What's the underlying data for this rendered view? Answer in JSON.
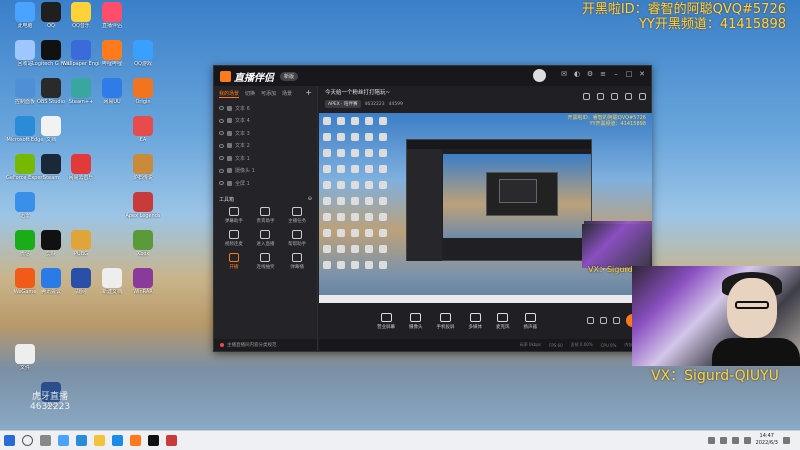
{
  "desktop": {
    "icons": [
      {
        "label": "此电脑",
        "color": "#4aa3ff"
      },
      {
        "label": "QQ",
        "color": "#1f1f1f"
      },
      {
        "label": "QQ音乐",
        "color": "#ffd23a"
      },
      {
        "label": "直播伴侣",
        "color": "#ff4d6a"
      },
      {
        "label": "回收站",
        "color": "#9ec7ff"
      },
      {
        "label": "Logitech G HUB",
        "color": "#111111"
      },
      {
        "label": "Wallpaper Engine",
        "color": "#3a6bd8"
      },
      {
        "label": "哔哩哔哩",
        "color": "#ff7a1a"
      },
      {
        "label": "QQ游戏",
        "color": "#3aa0ff"
      },
      {
        "label": "控制面板",
        "color": "#4f8fd6"
      },
      {
        "label": "OBS Studio",
        "color": "#2a2a2a"
      },
      {
        "label": "Steam++",
        "color": "#3aa6a0"
      },
      {
        "label": "网易UU",
        "color": "#2f7be8"
      },
      {
        "label": "Origin",
        "color": "#f2741f"
      },
      {
        "label": "Microsoft Edge",
        "color": "#2a8bd8"
      },
      {
        "label": "文档",
        "color": "#f2f2f2"
      },
      {
        "label": "EA",
        "color": "#e84b4b"
      },
      {
        "label": "GeForce Experience",
        "color": "#76b900"
      },
      {
        "label": "Steam",
        "color": "#1b2838"
      },
      {
        "label": "网易云音乐",
        "color": "#e23a3a"
      },
      {
        "label": "炉石传说",
        "color": "#c98a3a"
      },
      {
        "label": "迅雷",
        "color": "#3a8fe8"
      },
      {
        "label": "Apex Legends",
        "color": "#c93a3a"
      },
      {
        "label": "微信",
        "color": "#1aad19"
      },
      {
        "label": "剪映",
        "color": "#111111"
      },
      {
        "label": "PUBG",
        "color": "#e0a53a"
      },
      {
        "label": "Xbox",
        "color": "#5a9a3a"
      },
      {
        "label": "WeGame",
        "color": "#f25a1a"
      },
      {
        "label": "腾讯会议",
        "color": "#2a7be8"
      },
      {
        "label": "战网",
        "color": "#2a4fa8"
      },
      {
        "label": "新建文档",
        "color": "#eeeeee"
      },
      {
        "label": "WinRAR",
        "color": "#8a3a9a"
      },
      {
        "label": "文件",
        "color": "#eeeeee"
      },
      {
        "label": "Arc",
        "color": "#2a4f8a"
      }
    ]
  },
  "overlay": {
    "line1": "开黑啦ID：睿智的阿聪QVQ#5726",
    "line2": "YY开黑频道：41415898"
  },
  "app": {
    "logo": "直播伴侣",
    "version": "新版",
    "left_tabs": [
      "我的场景",
      "切换",
      "可添加",
      "场景"
    ],
    "sources": [
      "文本 6",
      "文本 4",
      "文本 3",
      "文本 2",
      "文本 1",
      "摄像头 1",
      "全屏 1"
    ],
    "tools_title": "工具箱",
    "tools": [
      {
        "label": "弹幕助手",
        "hot": false
      },
      {
        "label": "贵宾助手",
        "hot": false
      },
      {
        "label": "主播任务",
        "hot": false
      },
      {
        "label": "视频连麦",
        "hot": false
      },
      {
        "label": "进入直播",
        "hot": false
      },
      {
        "label": "帮帮助手",
        "hot": false
      },
      {
        "label": "开播",
        "hot": true
      },
      {
        "label": "连线抽奖",
        "hot": false
      },
      {
        "label": "弹幕播",
        "hot": false
      }
    ],
    "footer": "主播直播间内容分类规范",
    "room_title": "今天给一个粉丝打打陪玩~",
    "category": "APEX · 陪伴赛",
    "room_id": "4632223",
    "viewers": "44599",
    "toolbar": [
      {
        "label": "营业屏幕"
      },
      {
        "label": "摄像头"
      },
      {
        "label": "手机投屏"
      },
      {
        "label": "多媒体"
      },
      {
        "label": "麦克风"
      },
      {
        "label": "扬声器"
      }
    ],
    "go_live": "下播",
    "status": [
      "码率 0kbps",
      "FPS 60",
      "丢帧 0.00%",
      "CPU 0%",
      "内存 0%"
    ],
    "preview_watermark1": "开黑啦ID：睿智的阿聪QVQ#5726",
    "preview_watermark2": "YY开黑频道：41415898",
    "preview_vx": "VX：Sigurd"
  },
  "cam": {
    "vx_small": "VX：Sigurd",
    "vx_big": "VX：Sigurd-QIUYU"
  },
  "watermark_bl": {
    "line1": "虎牙直播",
    "line2": "4632223"
  },
  "taskbar": {
    "time": "14:47",
    "date": "2022/6/3"
  }
}
